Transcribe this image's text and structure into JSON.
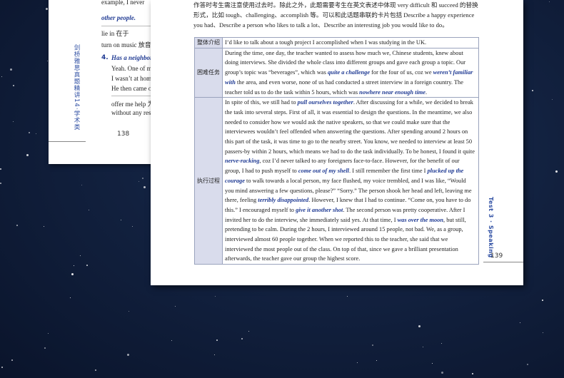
{
  "back_page": {
    "side_title": "剑桥雅思真题精讲14·学术类",
    "lines": [
      {
        "text": "other people.",
        "style": "blue"
      },
      {
        "text": "lie in 在于",
        "style": "plain"
      },
      {
        "text": "turn on music 放音",
        "style": "plain"
      },
      {
        "text": "Has a neighbor ev",
        "style": "blue"
      },
      {
        "text": "Yeah. One of my n",
        "style": "plain"
      },
      {
        "text": "I wasn’t at home. Y",
        "style": "plain"
      },
      {
        "text": "He then came out a",
        "style": "plain"
      },
      {
        "text": "offer me help 为我",
        "style": "plain"
      },
      {
        "text": "without any respon",
        "style": "plain"
      }
    ],
    "top_line": "example, I never",
    "question_number": "4.",
    "page_number": "138"
  },
  "main_page": {
    "intro_lines": [
      "作答时考生需注意使用过去时。除此之外，此题需要考生在英文表述中体现 very difficult 和 succeed 的替换",
      "形式，比如 tough、challenging、accomplish 等。可以和此话题串联的卡片包括 Describe a happy experience",
      "you had、Describe a person who likes to talk a lot、Describe an interesting job you would like to do。"
    ],
    "rows": [
      {
        "label": "整体介绍",
        "segments": [
          {
            "t": "I’d like to talk about a tough project I accomplished when I was studying in the UK."
          }
        ]
      },
      {
        "label": "困难任务",
        "segments": [
          {
            "t": "During the time, one day, the teacher wanted to assess how much we, Chinese students, knew about doing interviews. She divided the whole class into different groups and gave each group a topic. Our group’s topic was “beverages”, which was "
          },
          {
            "t": "quite a challenge",
            "h": true
          },
          {
            "t": " for the four of us, coz we "
          },
          {
            "t": "weren’t familiar with",
            "h": true
          },
          {
            "t": " the area, and even worse, none of us had conducted a street interview in a foreign country. The teacher told us to do the task within 5 hours, which was "
          },
          {
            "t": "nowhere near enough time",
            "h": true
          },
          {
            "t": "."
          }
        ]
      },
      {
        "label": "执行过程",
        "segments": [
          {
            "t": "In spite of this, we still had to "
          },
          {
            "t": "pull ourselves together",
            "h": true
          },
          {
            "t": ". After discussing for a while, we decided to break the task into several steps. First of all, it was essential to design the questions. In the meantime, we also needed to consider how we would ask the native speakers, so that we could make sure that the interviewees wouldn’t feel offended when answering the questions. After spending around 2 hours on this part of the task, it was time to go to the nearby street. You know, we needed to interview at least 50 passers-by within 2 hours, which means we had to do the task individually. To be honest, I found it quite "
          },
          {
            "t": "nerve-racking",
            "h": true
          },
          {
            "t": ", coz I’d never talked to any foreigners face-to-face. However, for the benefit of our group, I had to push myself to "
          },
          {
            "t": "come out of my shell",
            "h": true
          },
          {
            "t": ". I still remember the first time I "
          },
          {
            "t": "plucked up the courage",
            "h": true
          },
          {
            "t": " to walk towards a local person, my face flushed, my voice trembled, and I was like, “Would you mind answering a few questions, please?” “Sorry.” The person shook her head and left, leaving me there, feeling "
          },
          {
            "t": "terribly disappointed",
            "h": true
          },
          {
            "t": ". However, I knew that I had to continue. “Come on, you have to do this.” I encouraged myself to "
          },
          {
            "t": "give it another shot",
            "h": true
          },
          {
            "t": ". The second person was pretty cooperative. After I invited her to do the interview, she immediately said yes. At that time, I "
          },
          {
            "t": "was over the moon",
            "h": true
          },
          {
            "t": ", but still, pretending to be calm. During the 2 hours, I interviewed around 15 people, not bad. We, as a group, interviewed almost 60 people together. When we reported this to the teacher, she said that we interviewed the most people out of the class. On top of that, since we gave a brilliant presentation afterwards, the teacher gave our group the highest score."
          }
        ]
      }
    ],
    "side_tab": "Test 3 · Speaking",
    "page_number": "139"
  },
  "colors": {
    "highlight": "#1f3a93",
    "label_bg": "#d9dcec",
    "sky": "#12213f"
  }
}
